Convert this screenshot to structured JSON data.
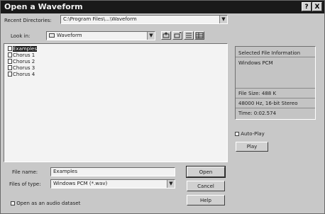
{
  "window": {
    "title": "Open a Waveform",
    "help_glyph": "?",
    "close_glyph": "X"
  },
  "recent_dirs": {
    "label": "Recent Directories:",
    "value": "C:\\Program Files\\...\\Waveform"
  },
  "look_in": {
    "label": "Look in:",
    "value": "Waveform"
  },
  "files": [
    "Examples",
    "Chorus 1",
    "Chorus 2",
    "Chorus 3",
    "Chorus 4"
  ],
  "file_name": {
    "label": "File name:",
    "value": "Examples"
  },
  "file_type": {
    "label": "Files of type:",
    "value": "Windows PCM (*.wav)"
  },
  "buttons": {
    "open": "Open",
    "cancel": "Cancel",
    "help": "Help",
    "play": "Play"
  },
  "open_audio_label": "Open as an audio dataset",
  "info": {
    "header": "Selected File Information",
    "format": "Windows PCM",
    "file_size": "File Size: 488 K",
    "sample_info": "48000 Hz, 16-bit Stereo",
    "time": "Time: 0:02.574"
  },
  "auto_play_label": "Auto-Play",
  "colors": {
    "titlebar": "#1a1a1a",
    "selection": "#1a1a1a",
    "face": "#c8c8c8"
  }
}
